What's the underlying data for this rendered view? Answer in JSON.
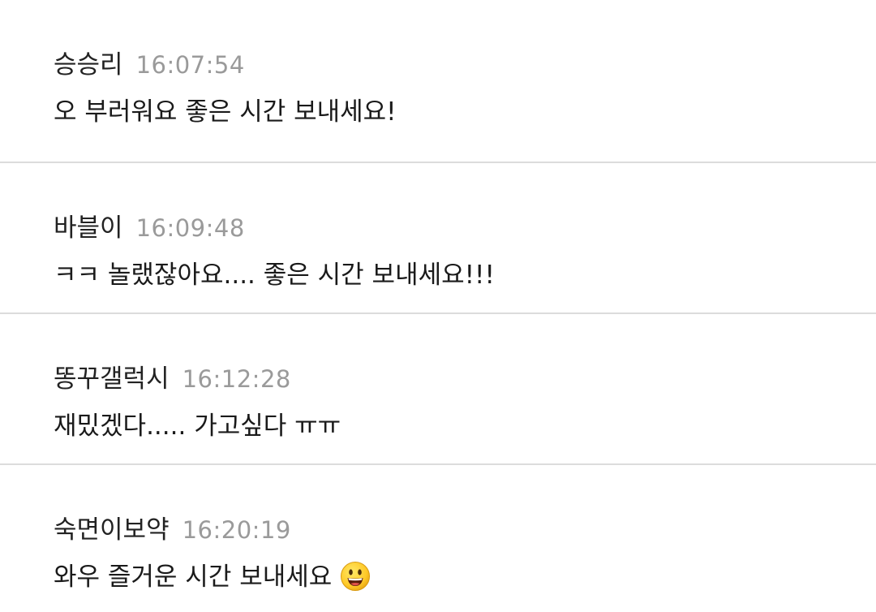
{
  "comments": [
    {
      "author": "승승리",
      "time": "16:07:54",
      "text": "오 부러워요 좋은 시간 보내세요!"
    },
    {
      "author": "바블이",
      "time": "16:09:48",
      "text": "ㅋㅋ 놀랬잖아요.... 좋은 시간 보내세요!!!"
    },
    {
      "author": "똥꾸갤럭시",
      "time": "16:12:28",
      "text": "재밌겠다..... 가고싶다 ㅠㅠ"
    },
    {
      "author": "숙면이보약",
      "time": "16:20:19",
      "text": "와우 즐거운 시간 보내세요",
      "emoji": "smiling-face-emoji"
    }
  ]
}
